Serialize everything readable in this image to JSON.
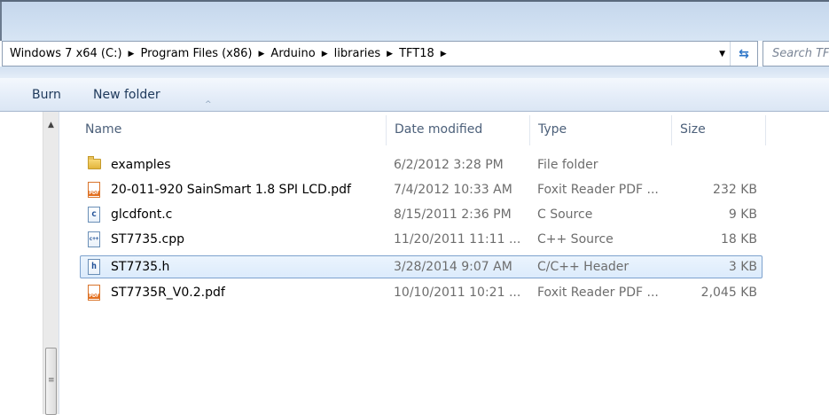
{
  "address": {
    "crumbs": [
      "Windows 7 x64 (C:)",
      "Program Files (x86)",
      "Arduino",
      "libraries",
      "TFT18"
    ],
    "search_placeholder": "Search TF"
  },
  "toolbar": {
    "burn_label": "Burn",
    "new_folder_label": "New folder"
  },
  "columns": {
    "name": "Name",
    "date_modified": "Date modified",
    "type": "Type",
    "size": "Size"
  },
  "files": [
    {
      "name": "examples",
      "date": "6/2/2012 3:28 PM",
      "type": "File folder",
      "size": "",
      "icon": "folder-icon"
    },
    {
      "name": "20-011-920 SainSmart 1.8 SPI LCD.pdf",
      "date": "7/4/2012 10:33 AM",
      "type": "Foxit Reader PDF ...",
      "size": "232 KB",
      "icon": "pdf-icon"
    },
    {
      "name": "glcdfont.c",
      "date": "8/15/2011 2:36 PM",
      "type": "C Source",
      "size": "9 KB",
      "icon": "c-source-icon"
    },
    {
      "name": "ST7735.cpp",
      "date": "11/20/2011 11:11 ...",
      "type": "C++ Source",
      "size": "18 KB",
      "icon": "cpp-source-icon"
    },
    {
      "name": "ST7735.h",
      "date": "3/28/2014 9:07 AM",
      "type": "C/C++ Header",
      "size": "3 KB",
      "icon": "header-icon",
      "selected": true
    },
    {
      "name": "ST7735R_V0.2.pdf",
      "date": "10/10/2011 10:21 ...",
      "type": "Foxit Reader PDF ...",
      "size": "2,045 KB",
      "icon": "pdf-icon"
    }
  ],
  "colors": {
    "selection_bg": "#dcebfc",
    "selection_border": "#7da2ce",
    "toolbar_text": "#1e395b"
  }
}
